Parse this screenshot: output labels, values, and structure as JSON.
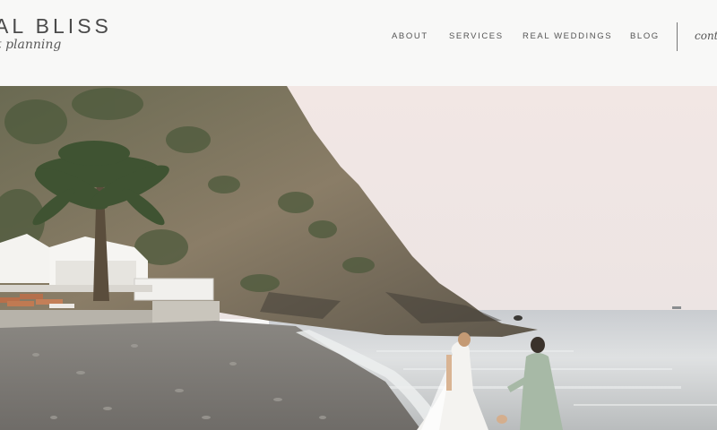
{
  "header": {
    "logo_title": "AL BLISS",
    "logo_script": "t planning",
    "nav": [
      "ABOUT",
      "SERVICES",
      "REAL WEDDINGS",
      "BLOG"
    ],
    "contact_label": "conta"
  },
  "hero": {
    "image": "wedding-beach-photo",
    "colors": {
      "sky": "#efe3df",
      "sea": "#d9dde0",
      "cliff": "#7d7462",
      "beach": "#8c8a86",
      "suit": "#a9bba8",
      "dress": "#f5f4f1"
    }
  }
}
